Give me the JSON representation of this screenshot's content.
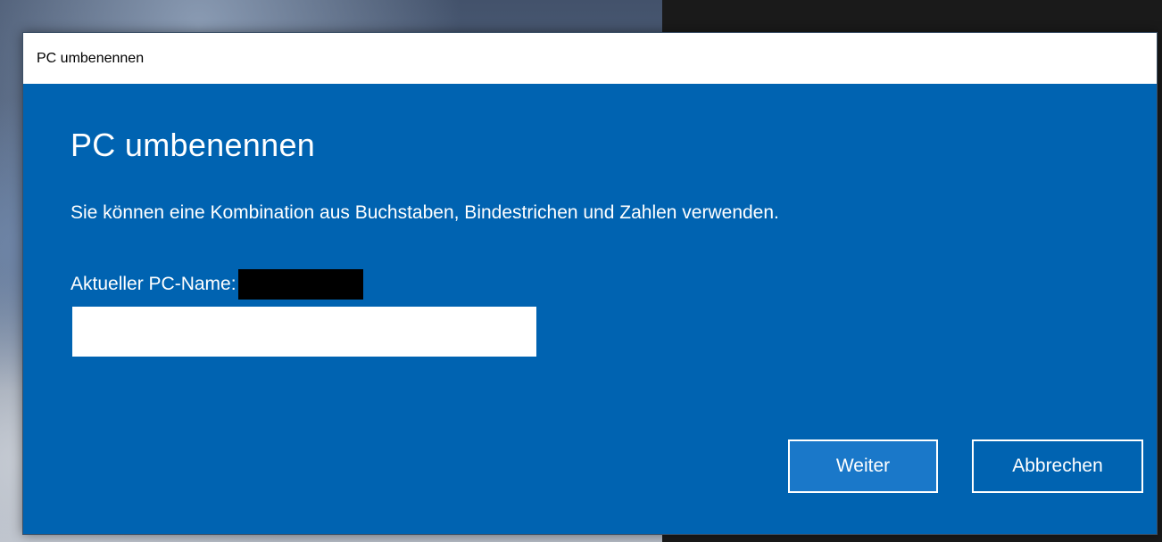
{
  "dialog": {
    "window_title": "PC umbenennen",
    "heading": "PC umbenennen",
    "description": "Sie können eine Kombination aus Buchstaben, Bindestrichen und Zahlen verwenden.",
    "current_name_label": "Aktueller PC-Name:",
    "name_input": {
      "value": "",
      "placeholder": ""
    },
    "buttons": {
      "next_label": "Weiter",
      "cancel_label": "Abbrechen"
    }
  },
  "colors": {
    "accent": "#0063b1",
    "titlebar": "#ffffff",
    "text": "#ffffff",
    "next_button": "#1a78c9"
  }
}
